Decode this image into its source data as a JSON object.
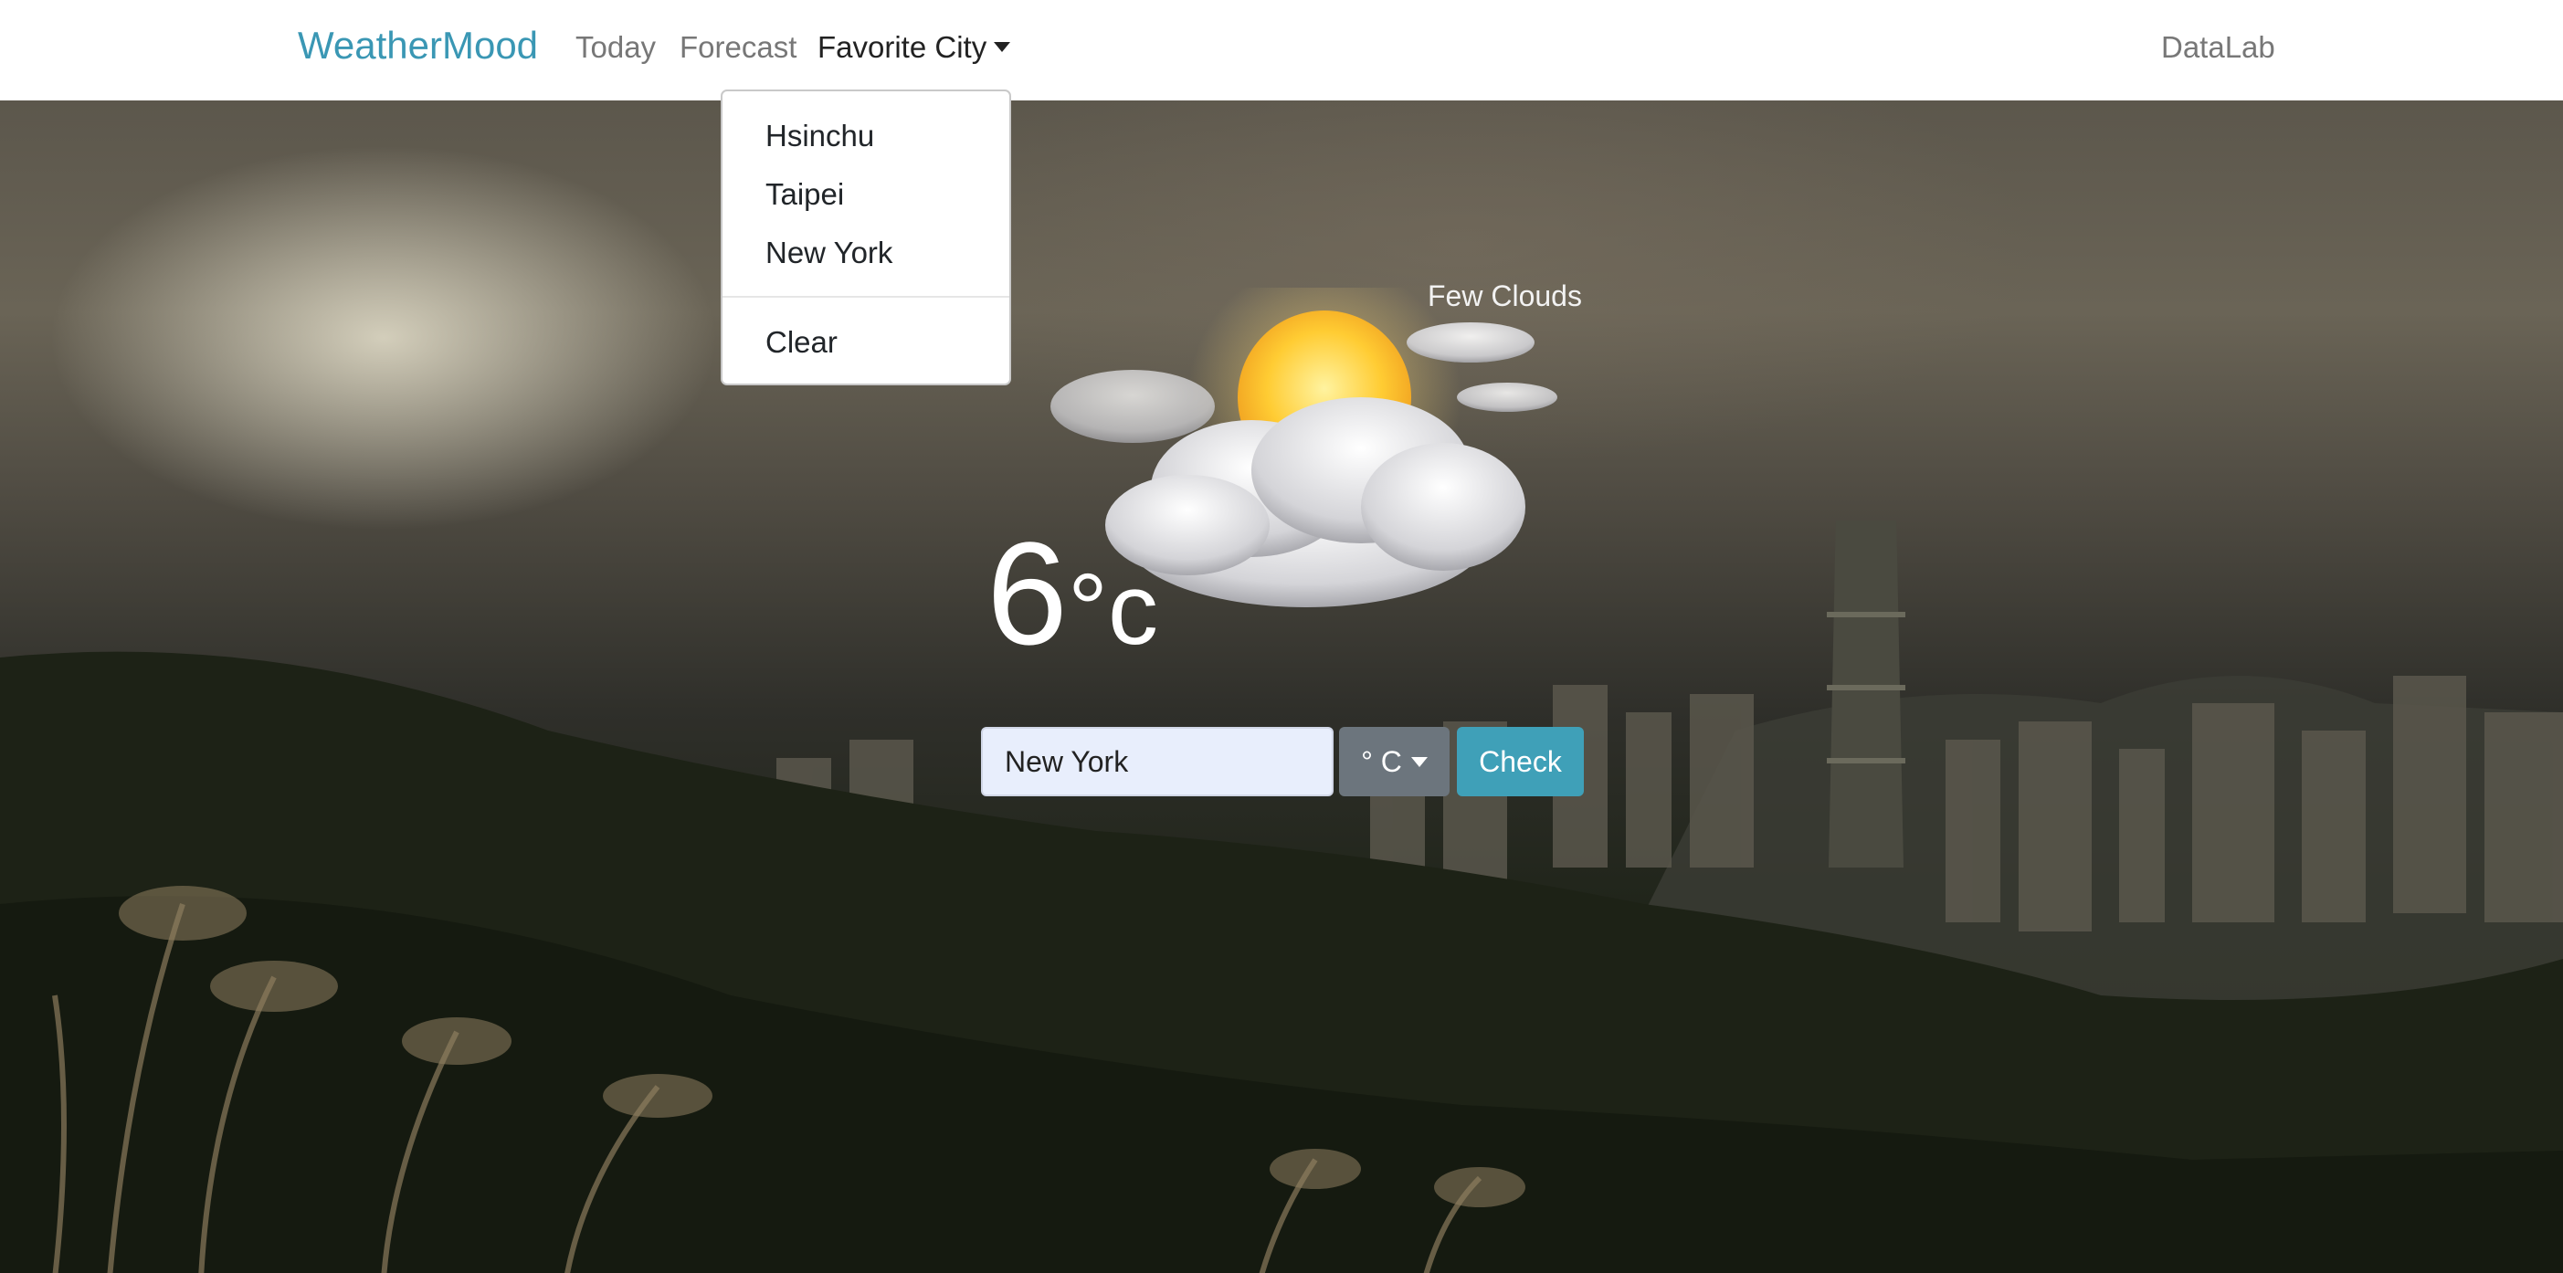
{
  "navbar": {
    "brand": "WeatherMood",
    "links": {
      "today": "Today",
      "forecast": "Forecast",
      "favorite_city": "Favorite City",
      "datalab": "DataLab"
    }
  },
  "favorite_dropdown": {
    "open": true,
    "cities": [
      "Hsinchu",
      "Taipei",
      "New York"
    ],
    "clear_label": "Clear"
  },
  "weather": {
    "condition": "Few Clouds",
    "temperature": "6",
    "unit_display": "°c",
    "icon": "sun-behind-cloud-icon"
  },
  "search": {
    "city_value": "New York",
    "unit_label": "° C",
    "check_label": "Check"
  },
  "colors": {
    "brand": "#3a97b4",
    "check_button": "#3fa0b8",
    "unit_button": "#6c757d",
    "input_bg": "#e8eefc"
  }
}
